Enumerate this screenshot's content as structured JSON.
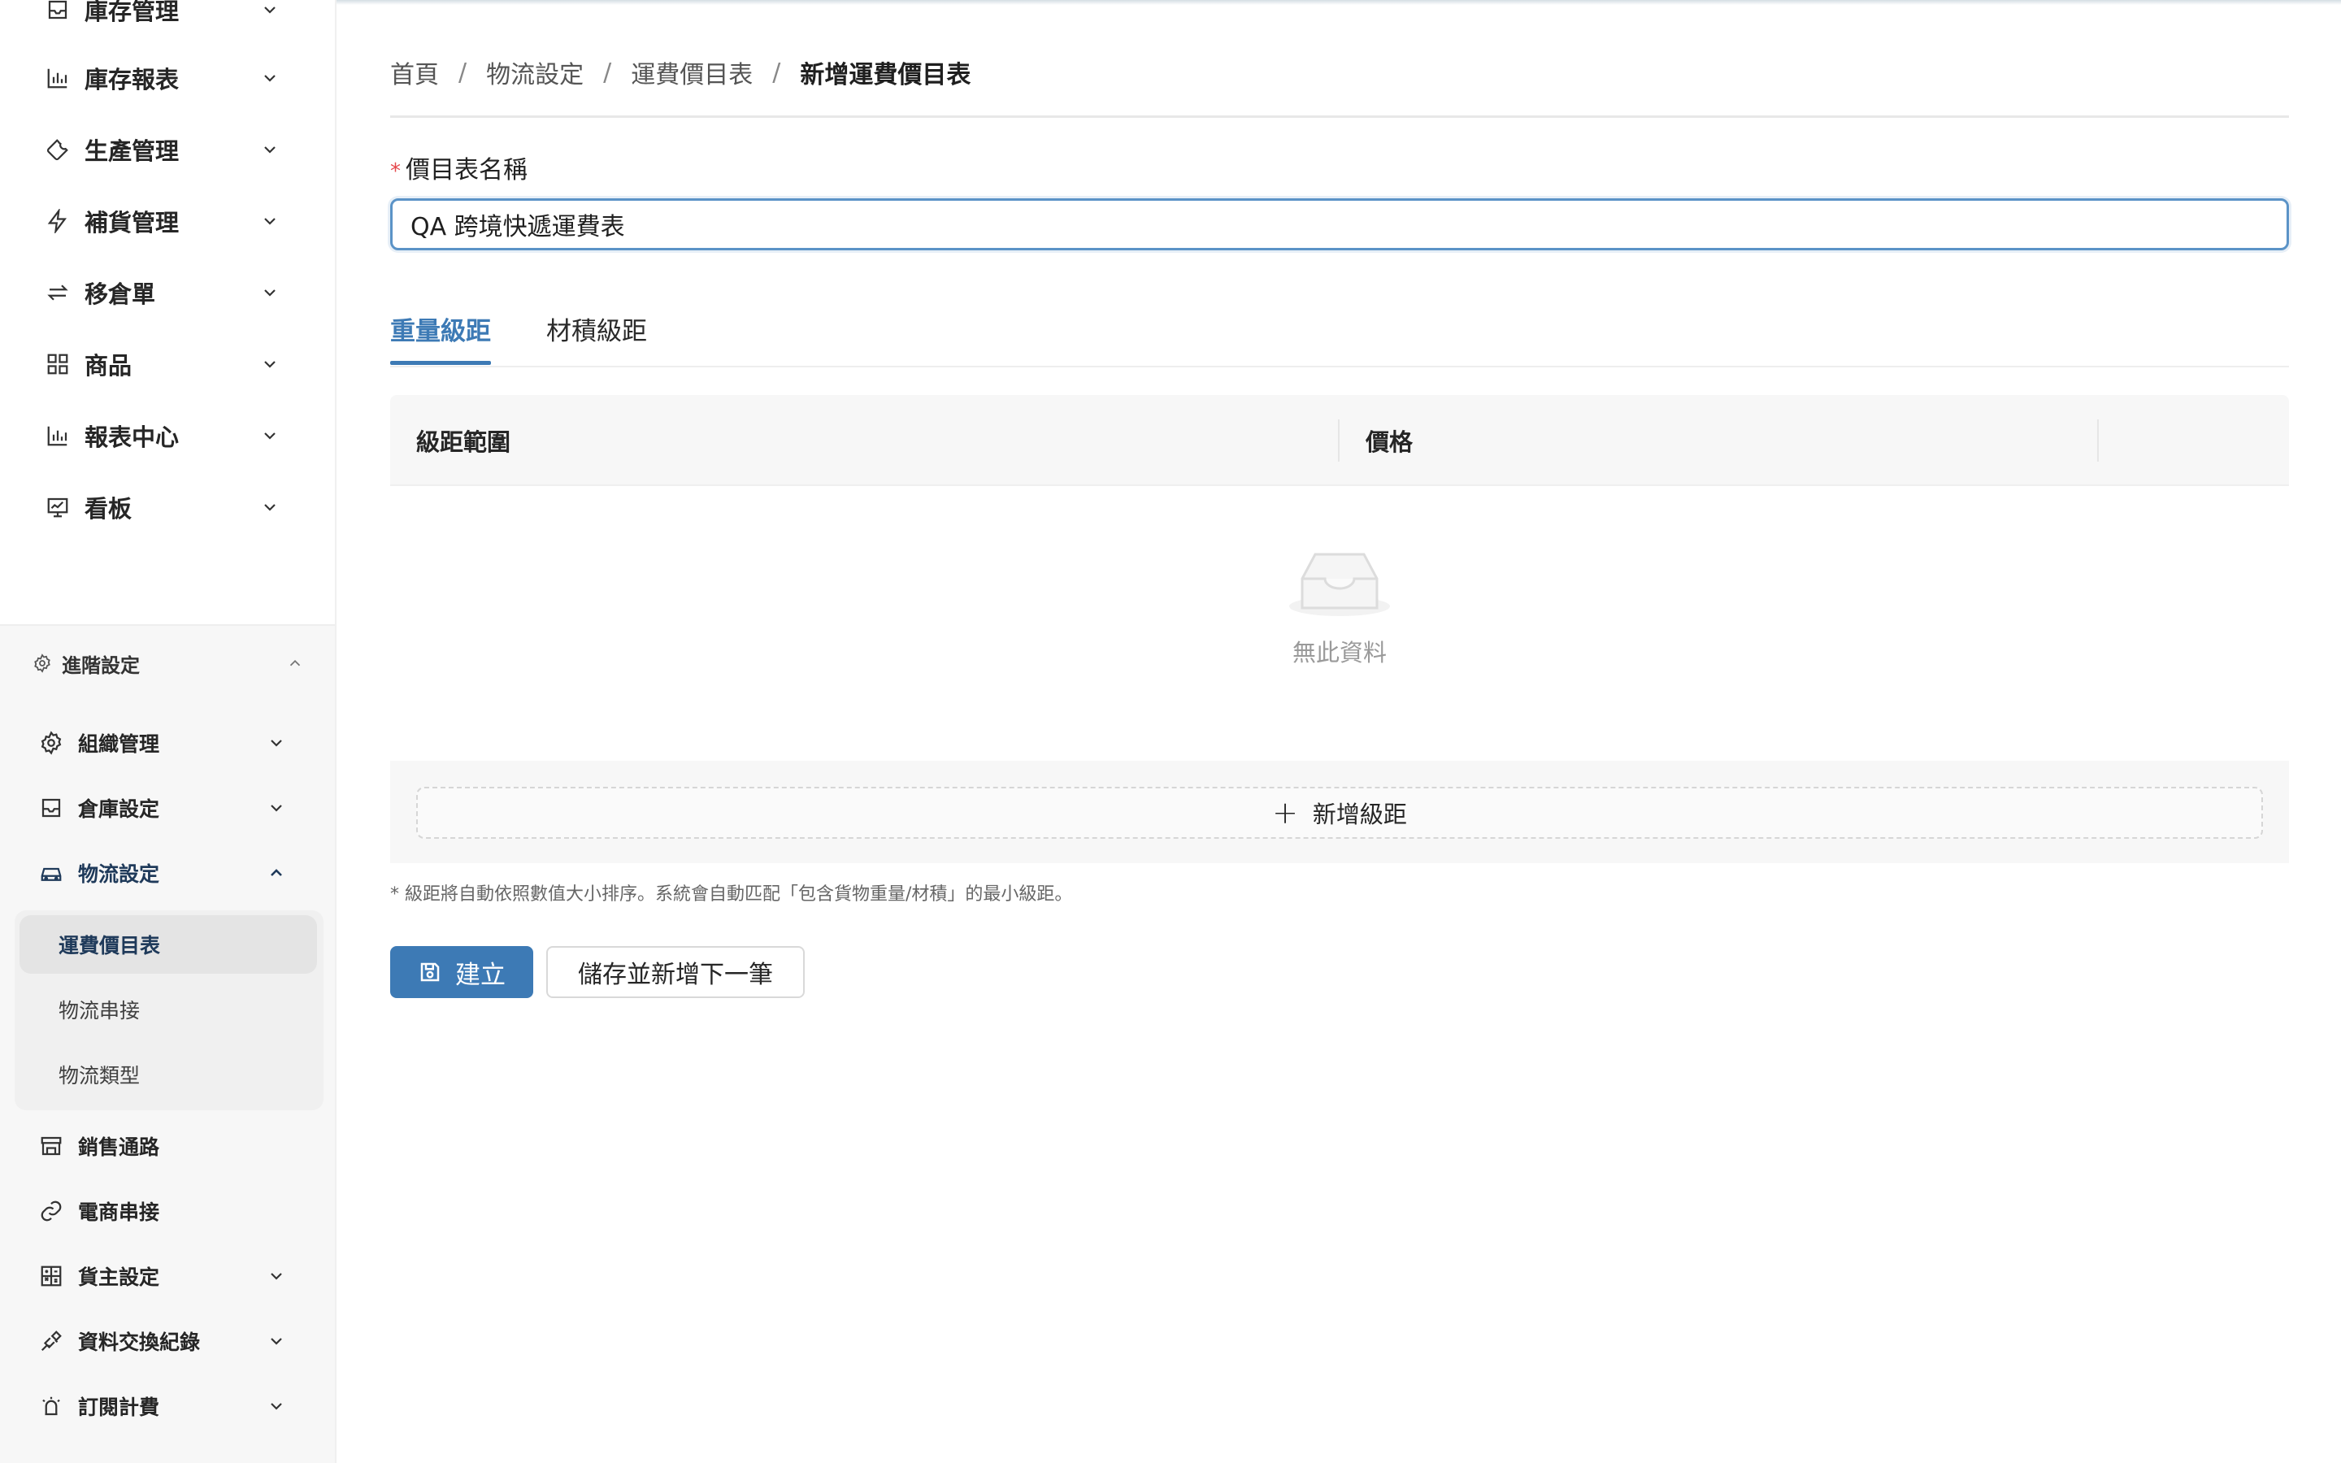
{
  "sidebar": {
    "top_items": [
      {
        "label": "庫存管理",
        "icon": "inbox-icon"
      },
      {
        "label": "庫存報表",
        "icon": "bar-chart-icon"
      },
      {
        "label": "生產管理",
        "icon": "wrench-icon"
      },
      {
        "label": "補貨管理",
        "icon": "lightning-icon"
      },
      {
        "label": "移倉單",
        "icon": "swap-icon"
      },
      {
        "label": "商品",
        "icon": "grid-icon"
      },
      {
        "label": "報表中心",
        "icon": "bar-chart-icon"
      },
      {
        "label": "看板",
        "icon": "dashboard-icon"
      }
    ],
    "section": {
      "label": "進階設定",
      "icon": "gear-icon",
      "items": [
        {
          "label": "組織管理",
          "icon": "gear-icon",
          "expandable": true
        },
        {
          "label": "倉庫設定",
          "icon": "inbox-icon",
          "expandable": true
        },
        {
          "label": "物流設定",
          "icon": "car-icon",
          "expandable": true,
          "expanded": true
        },
        {
          "label": "銷售通路",
          "icon": "shop-icon",
          "expandable": false
        },
        {
          "label": "電商串接",
          "icon": "link-icon",
          "expandable": false
        },
        {
          "label": "貨主設定",
          "icon": "calculator-icon",
          "expandable": true
        },
        {
          "label": "資料交換紀錄",
          "icon": "api-icon",
          "expandable": true
        },
        {
          "label": "訂閱計費",
          "icon": "alarm-icon",
          "expandable": true
        }
      ],
      "logistics_submenu": [
        {
          "label": "運費價目表",
          "active": true
        },
        {
          "label": "物流串接",
          "active": false
        },
        {
          "label": "物流類型",
          "active": false
        }
      ]
    }
  },
  "breadcrumb": {
    "items": [
      "首頁",
      "物流設定",
      "運費價目表"
    ],
    "current": "新增運費價目表",
    "separator": "/"
  },
  "form": {
    "name_label": "價目表名稱",
    "required_mark": "*",
    "name_value": "QA 跨境快遞運費表"
  },
  "tabs": [
    {
      "label": "重量級距",
      "active": true
    },
    {
      "label": "材積級距",
      "active": false
    }
  ],
  "table": {
    "columns": [
      "級距範圍",
      "價格"
    ],
    "empty_text": "無此資料",
    "add_label": "新增級距"
  },
  "hint": "* 級距將自動依照數值大小排序。系統會自動匹配「包含貨物重量/材積」的最小級距。",
  "actions": {
    "create_label": "建立",
    "save_next_label": "儲存並新增下一筆"
  },
  "colors": {
    "primary": "#3d7ab5",
    "required": "#e5484d",
    "focus_border": "#5b93c7"
  }
}
